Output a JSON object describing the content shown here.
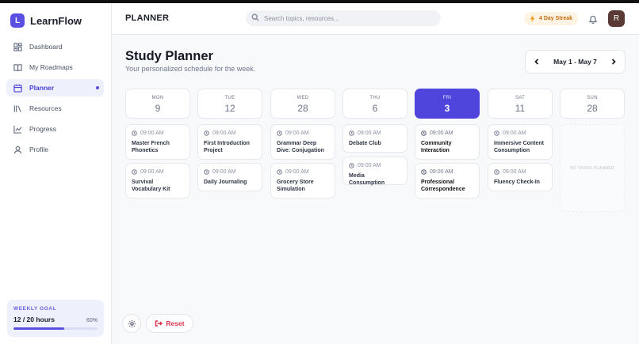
{
  "brand": {
    "logo_letter": "L",
    "name": "LearnFlow"
  },
  "sidebar": {
    "items": [
      {
        "label": "Dashboard",
        "icon": "dashboard-icon"
      },
      {
        "label": "My Roadmaps",
        "icon": "book-icon"
      },
      {
        "label": "Planner",
        "icon": "calendar-icon",
        "active": true
      },
      {
        "label": "Resources",
        "icon": "library-icon"
      },
      {
        "label": "Progress",
        "icon": "chart-icon"
      },
      {
        "label": "Profile",
        "icon": "user-icon"
      }
    ],
    "goal": {
      "title": "WEEKLY GOAL",
      "hours": "12 / 20 hours",
      "percent_label": "60%",
      "progress": 0.6
    }
  },
  "header": {
    "title": "PLANNER",
    "search_placeholder": "Search topics, resources...",
    "streak": "4 Day Streak",
    "avatar_letter": "R"
  },
  "main": {
    "title": "Study Planner",
    "subtitle": "Your personalized schedule for the week.",
    "week_range": "May 1 - May 7",
    "days": [
      {
        "name": "MON",
        "date": "9",
        "tasks": [
          {
            "time": "09:00 AM",
            "title": "Master French Phonetics"
          },
          {
            "time": "09:00 AM",
            "title": "Survival Vocabulary Kit"
          }
        ]
      },
      {
        "name": "TUE",
        "date": "12",
        "tasks": [
          {
            "time": "09:00 AM",
            "title": "First Introduction Project"
          },
          {
            "time": "09:00 AM",
            "title": "Daily Journaling"
          }
        ]
      },
      {
        "name": "WED",
        "date": "28",
        "tasks": [
          {
            "time": "09:00 AM",
            "title": "Grammar Deep Dive: Conjugation"
          },
          {
            "time": "09:00 AM",
            "title": "Grocery Store Simulation"
          }
        ]
      },
      {
        "name": "THU",
        "date": "6",
        "tasks": [
          {
            "time": "09:00 AM",
            "title": "Debate Club"
          },
          {
            "time": "09:00 AM",
            "title": "Media Consumption"
          }
        ]
      },
      {
        "name": "FRI",
        "date": "3",
        "today": true,
        "tasks": [
          {
            "time": "09:00 AM",
            "title": "Community Interaction"
          },
          {
            "time": "09:00 AM",
            "title": "Professional Correspondence"
          }
        ]
      },
      {
        "name": "SAT",
        "date": "11",
        "tasks": [
          {
            "time": "09:00 AM",
            "title": "Immersive Content Consumption"
          },
          {
            "time": "09:00 AM",
            "title": "Fluency Check-In"
          }
        ]
      },
      {
        "name": "SUN",
        "date": "28",
        "tasks": []
      }
    ],
    "empty_label": "NO TASKS PLANNED",
    "reset_label": "Reset"
  },
  "colors": {
    "accent": "#4f44dc",
    "streak": "#f29a1b",
    "danger": "#e0334f"
  }
}
